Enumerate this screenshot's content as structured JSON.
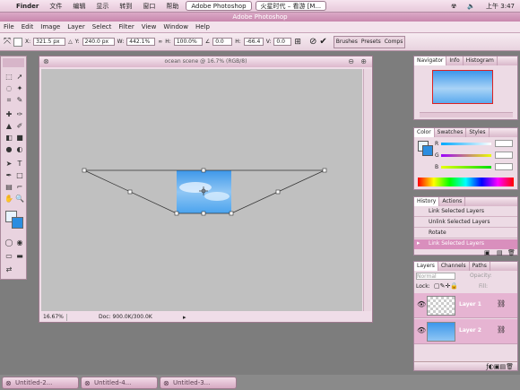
{
  "menubar": {
    "apple": "",
    "items": [
      "Finder",
      "文件",
      "编辑",
      "显示",
      "转到",
      "窗口",
      "帮助"
    ],
    "tasks": [
      "Adobe Photoshop",
      "火星时代 – 看游 [M..."
    ],
    "clock": "上午 3:47"
  },
  "app_title": "Adobe Photoshop",
  "ps_menu": [
    "File",
    "Edit",
    "Image",
    "Layer",
    "Select",
    "Filter",
    "View",
    "Window",
    "Help"
  ],
  "options": {
    "x_label": "X:",
    "x_value": "321.5 px",
    "y_label": "Y:",
    "y_value": "240.0 px",
    "w_label": "W:",
    "w_value": "442.1%",
    "h_label": "H:",
    "h_value": "100.0%",
    "angle_value": "0.0",
    "hskew_label": "H:",
    "hskew_value": "-66.4",
    "vskew_label": "V:",
    "vskew_value": "0.0",
    "palette_tabs": [
      "Brushes",
      "Presets",
      "Comps"
    ]
  },
  "document": {
    "title": "ocean scene @ 16.7% (RGB/8)",
    "zoom": "16.67%",
    "doc_info": "Doc: 900.0K/300.0K"
  },
  "navigator": {
    "tabs": [
      "Navigator",
      "Info",
      "Histogram"
    ]
  },
  "color": {
    "tabs": [
      "Color",
      "Swatches",
      "Styles"
    ],
    "channels": [
      {
        "label": "R",
        "value": ""
      },
      {
        "label": "G",
        "value": ""
      },
      {
        "label": "B",
        "value": ""
      }
    ]
  },
  "history": {
    "tabs": [
      "History",
      "Actions"
    ],
    "items": [
      "Link Selected Layers",
      "Unlink Selected Layers",
      "Rotate",
      "Link Selected Layers"
    ],
    "selected_index": 3
  },
  "layers": {
    "tabs": [
      "Layers",
      "Channels",
      "Paths"
    ],
    "blend": "Normal",
    "opacity_label": "Opacity:",
    "fill_label": "Fill:",
    "lock_label": "Lock:",
    "items": [
      "Layer 1",
      "Layer 2"
    ]
  },
  "dock": [
    "Untitled-2...",
    "Untitled-4...",
    "Untitled-3..."
  ],
  "colors": {
    "accent": "#d98fbd",
    "highlight": "#e6b4d2",
    "sky": "#4ea6ef"
  }
}
